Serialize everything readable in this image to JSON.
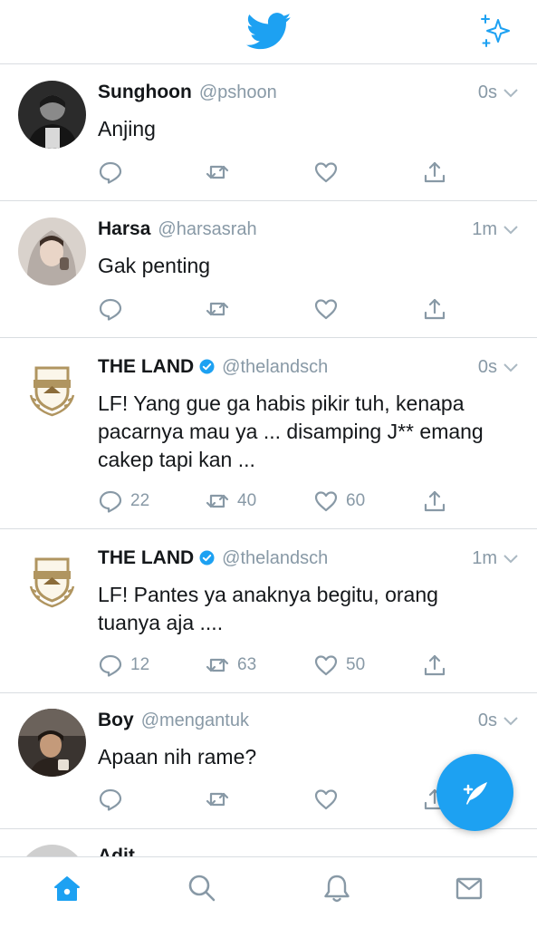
{
  "topbar": {
    "logo_icon": "twitter-bird-icon",
    "sparkle_icon": "sparkle-icon"
  },
  "tweets": [
    {
      "name": "Sunghoon",
      "handle": "@pshoon",
      "time": "0s",
      "verified": false,
      "text": "Anjing",
      "replies": "",
      "retweets": "",
      "likes": ""
    },
    {
      "name": "Harsa",
      "handle": "@harsasrah",
      "time": "1m",
      "verified": false,
      "text": "Gak penting",
      "replies": "",
      "retweets": "",
      "likes": ""
    },
    {
      "name": "THE LAND",
      "handle": "@thelandsch",
      "time": "0s",
      "verified": true,
      "text": "LF! Yang gue ga habis pikir tuh, kenapa pacarnya mau ya ... disamping J** emang cakep tapi kan ...",
      "replies": "22",
      "retweets": "40",
      "likes": "60"
    },
    {
      "name": "THE LAND",
      "handle": "@thelandsch",
      "time": "1m",
      "verified": true,
      "text": "LF! Pantes ya anaknya begitu, orang tuanya aja ....",
      "replies": "12",
      "retweets": "63",
      "likes": "50"
    },
    {
      "name": "Boy",
      "handle": "@mengantuk",
      "time": "0s",
      "verified": false,
      "text": "Apaan nih rame?",
      "replies": "",
      "retweets": "",
      "likes": ""
    },
    {
      "name": "Adit",
      "handle": "",
      "time": "",
      "verified": false,
      "text": "",
      "replies": "",
      "retweets": "",
      "likes": ""
    }
  ],
  "fab": {
    "icon": "compose-feather-icon"
  },
  "tabbar": {
    "items": [
      "home-icon",
      "search-icon",
      "notifications-icon",
      "messages-icon"
    ],
    "active": "home-icon"
  },
  "colors": {
    "accent": "#1da1f2",
    "muted": "#8899a6",
    "text": "#14171a",
    "divider": "#d9dde1"
  }
}
